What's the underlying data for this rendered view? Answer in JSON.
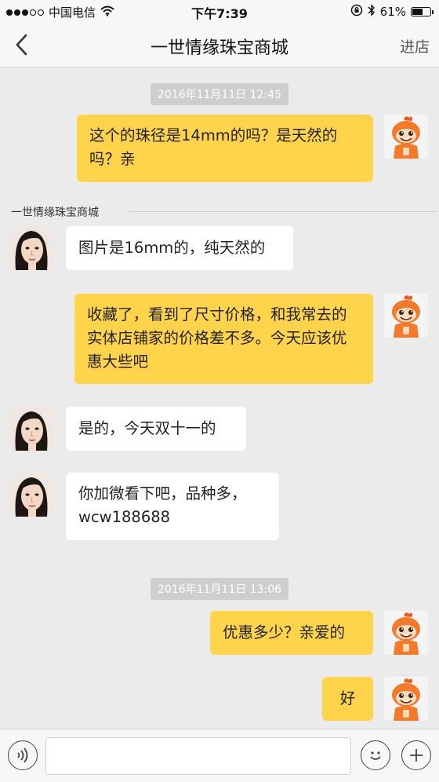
{
  "status_bar": {
    "carrier": "中国电信",
    "time": "下午7:39",
    "battery": "61%",
    "battery_level": 0.61
  },
  "nav": {
    "title": "一世情缘珠宝商城",
    "right_action": "进店"
  },
  "chat": {
    "timestamps": [
      "2016年11月11日 12:45",
      "2016年11月11日 13:06"
    ],
    "sender_name": "一世情缘珠宝商城",
    "messages": [
      {
        "from": "me",
        "text": "这个的珠径是14mm的吗？是天然的吗？亲"
      },
      {
        "from": "other",
        "text": "图片是16mm的，纯天然的"
      },
      {
        "from": "me",
        "text": "收藏了，看到了尺寸价格，和我常去的实体店铺家的价格差不多。今天应该优惠大些吧"
      },
      {
        "from": "other",
        "text": "是的，今天双十一的"
      },
      {
        "from": "other",
        "text": "你加微看下吧，品种多，wcw188688"
      },
      {
        "from": "me",
        "text": "优惠多少？亲爱的"
      },
      {
        "from": "me",
        "text": "好"
      }
    ]
  },
  "input": {
    "value": "",
    "placeholder": ""
  },
  "icons": {
    "back": "chevron-left-icon",
    "voice": "voice-icon",
    "emoji": "smiley-icon",
    "plus": "plus-icon",
    "wifi": "wifi-icon",
    "bluetooth": "bluetooth-icon",
    "lock": "orientation-lock-icon"
  },
  "colors": {
    "my_bubble": "#ffd34a",
    "other_bubble": "#ffffff",
    "background": "#ebebeb",
    "timestamp_bg": "#cecece"
  }
}
